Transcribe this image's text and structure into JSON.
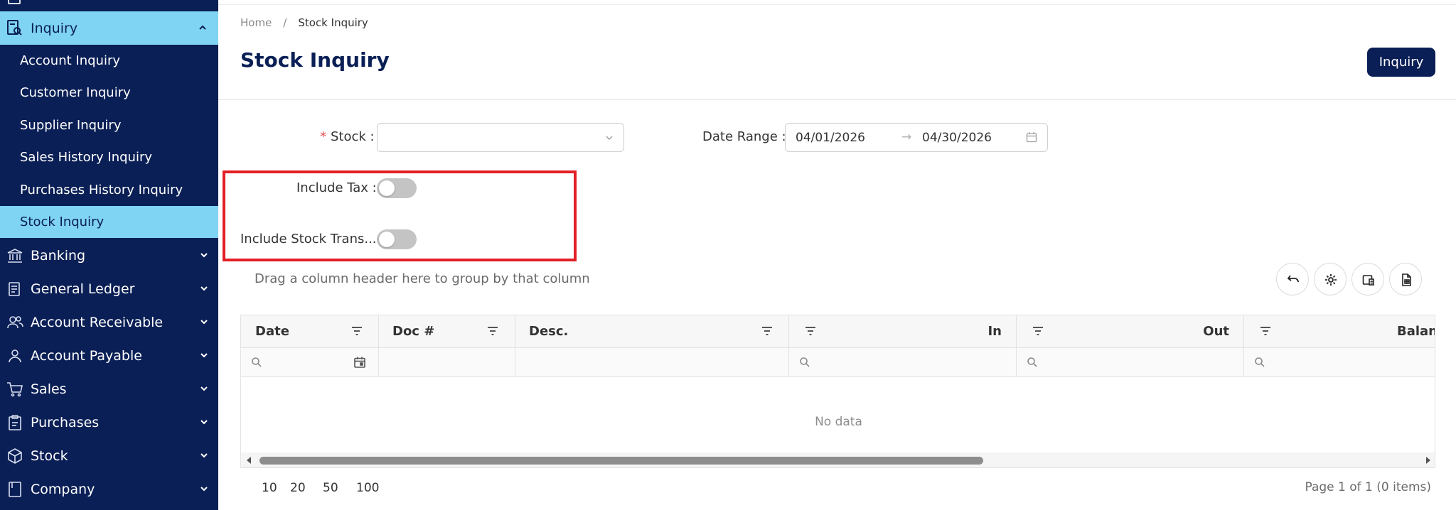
{
  "sidebar": {
    "group": {
      "label": "Inquiry"
    },
    "sub_items": [
      {
        "label": "Account Inquiry"
      },
      {
        "label": "Customer Inquiry"
      },
      {
        "label": "Supplier Inquiry"
      },
      {
        "label": "Sales History Inquiry"
      },
      {
        "label": "Purchases History Inquiry"
      },
      {
        "label": "Stock Inquiry",
        "active": true
      }
    ],
    "items": [
      {
        "label": "Banking",
        "icon": "bank-icon"
      },
      {
        "label": "General Ledger",
        "icon": "ledger-icon"
      },
      {
        "label": "Account Receivable",
        "icon": "users-icon"
      },
      {
        "label": "Account Payable",
        "icon": "user-icon"
      },
      {
        "label": "Sales",
        "icon": "cart-icon"
      },
      {
        "label": "Purchases",
        "icon": "clipboard-icon"
      },
      {
        "label": "Stock",
        "icon": "box-icon"
      },
      {
        "label": "Company",
        "icon": "book-icon"
      }
    ]
  },
  "breadcrumb": {
    "home": "Home",
    "separator": "/",
    "current": "Stock Inquiry"
  },
  "header": {
    "title": "Stock Inquiry",
    "action_label": "Inquiry"
  },
  "form": {
    "stock_label": "Stock :",
    "stock_required_mark": "*",
    "stock_value": "",
    "date_range_label": "Date Range :",
    "date_from": "04/01/2026",
    "date_arrow": "→",
    "date_to": "04/30/2026",
    "include_tax_label": "Include Tax :",
    "include_tax_on": false,
    "include_stock_trans_label": "Include Stock Trans... :",
    "include_stock_trans_on": false
  },
  "grid": {
    "group_hint": "Drag a column header here to group by that column",
    "columns": [
      {
        "label": "Date"
      },
      {
        "label": "Doc #"
      },
      {
        "label": "Desc."
      },
      {
        "label": "In"
      },
      {
        "label": "Out"
      },
      {
        "label": "Balan"
      }
    ],
    "empty_text": "No data"
  },
  "pager": {
    "sizes": [
      "10",
      "20",
      "50",
      "100"
    ],
    "info": "Page 1 of 1 (0 items)"
  },
  "colors": {
    "sidebar_bg": "#0a1f55",
    "sidebar_active": "#7fd3f3",
    "primary": "#0a1f55",
    "highlight_border": "#e31e24"
  }
}
